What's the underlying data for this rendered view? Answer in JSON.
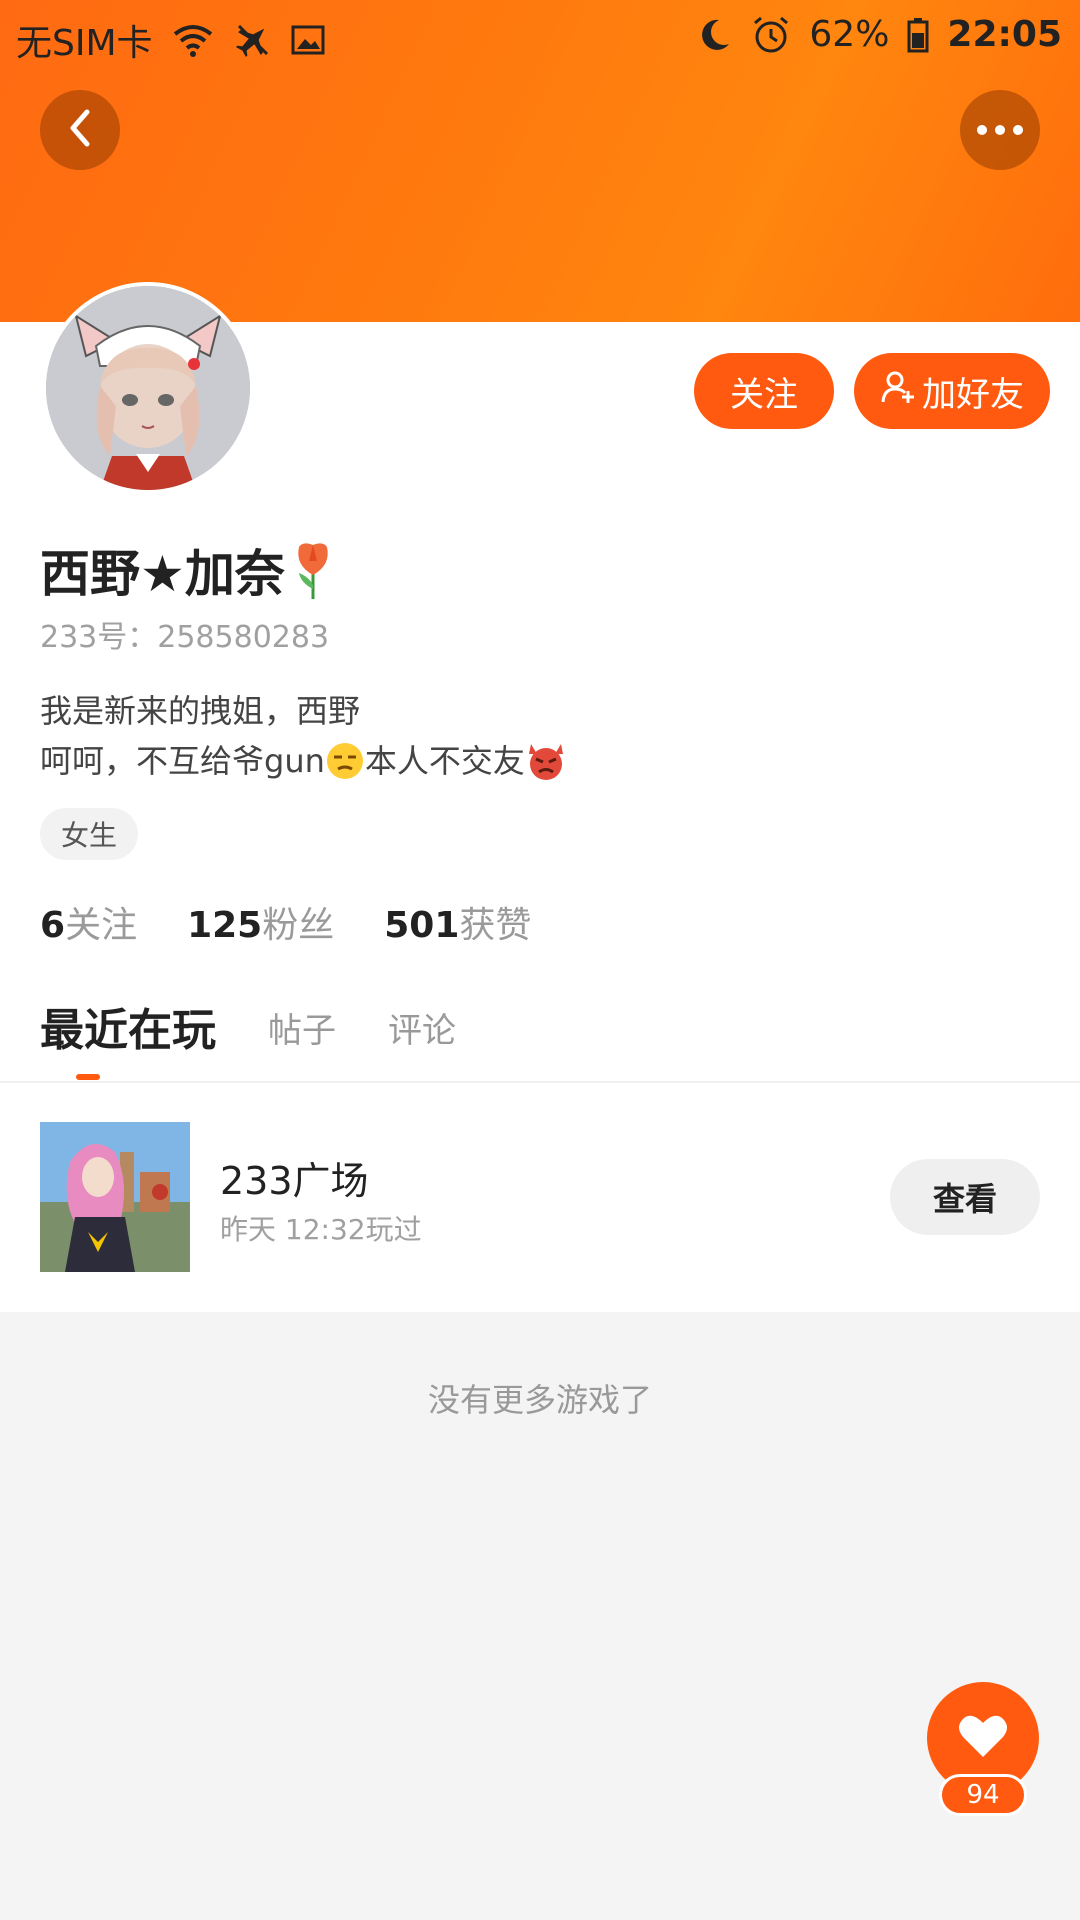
{
  "status_bar": {
    "carrier": "无SIM卡",
    "battery": "62%",
    "time": "22:05",
    "icons": [
      "wifi-icon",
      "airplane-mode-icon",
      "image-icon",
      "moon-icon",
      "alarm-icon",
      "battery-icon"
    ]
  },
  "header": {
    "back_icon": "chevron-left-icon",
    "more_icon": "more-dots-icon",
    "banner_color": "#ff7a0e"
  },
  "profile": {
    "name": "西野★加奈",
    "name_emoji": "tulip-emoji",
    "account_label": "233号：258580283",
    "bio_line1": "我是新来的拽姐，西野",
    "bio_line2_a": "呵呵，不互给爷gun",
    "bio_line2_b": "本人不交友",
    "bio_emojis": [
      "unamused-face-emoji",
      "angry-devil-emoji"
    ],
    "gender_tag": "女生"
  },
  "actions": {
    "follow_label": "关注",
    "add_friend_label": "加好友",
    "accent": "#ff5a0f"
  },
  "stats": [
    {
      "num": "6",
      "label": "关注"
    },
    {
      "num": "125",
      "label": "粉丝"
    },
    {
      "num": "501",
      "label": "获赞"
    }
  ],
  "tabs": {
    "active": "最近在玩",
    "tab2": "帖子",
    "tab3": "评论"
  },
  "game": {
    "title": "233广场",
    "played_time": "昨天 12:32玩过",
    "view_label": "查看"
  },
  "footer": {
    "no_more": "没有更多游戏了"
  },
  "like": {
    "count": "94"
  }
}
